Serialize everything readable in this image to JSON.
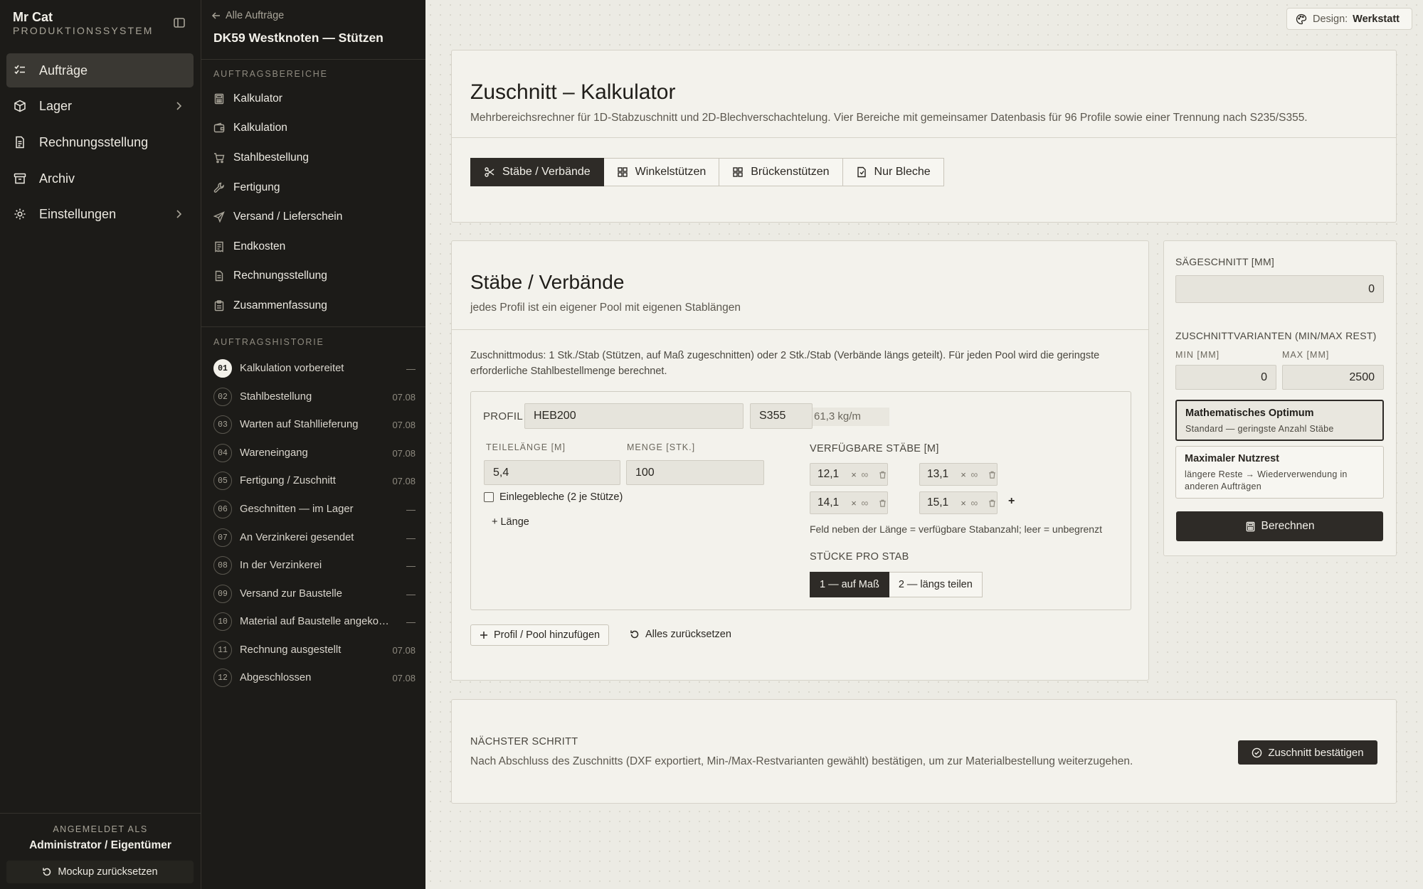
{
  "brand": {
    "name": "Mr Cat",
    "subtitle": "PRODUKTIONSSYSTEM"
  },
  "nav": [
    {
      "label": "Aufträge",
      "icon": "list-check-icon",
      "active": true
    },
    {
      "label": "Lager",
      "icon": "box-icon",
      "has_children": true
    },
    {
      "label": "Rechnungsstellung",
      "icon": "invoice-icon"
    },
    {
      "label": "Archiv",
      "icon": "archive-icon"
    },
    {
      "label": "Einstellungen",
      "icon": "gear-icon",
      "has_children": true
    }
  ],
  "user": {
    "label": "ANGEMELDET ALS",
    "name": "Administrator / Eigentümer",
    "reset_label": "Mockup zurücksetzen"
  },
  "order": {
    "back_label": "Alle Aufträge",
    "title": "DK59 Westknoten — Stützen",
    "areas_label": "AUFTRAGSBEREICHE",
    "areas": [
      {
        "label": "Kalkulator",
        "icon": "calculator-icon"
      },
      {
        "label": "Kalkulation",
        "icon": "wallet-icon"
      },
      {
        "label": "Stahlbestellung",
        "icon": "cart-icon"
      },
      {
        "label": "Fertigung",
        "icon": "wrench-icon"
      },
      {
        "label": "Versand / Lieferschein",
        "icon": "send-icon"
      },
      {
        "label": "Endkosten",
        "icon": "receipt-icon"
      },
      {
        "label": "Rechnungsstellung",
        "icon": "document-icon"
      },
      {
        "label": "Zusammenfassung",
        "icon": "clipboard-icon"
      }
    ],
    "history_label": "AUFTRAGSHISTORIE",
    "history": [
      {
        "num": "01",
        "label": "Kalkulation vorbereitet",
        "date": "—",
        "current": true
      },
      {
        "num": "02",
        "label": "Stahlbestellung",
        "date": "07.08"
      },
      {
        "num": "03",
        "label": "Warten auf Stahllieferung",
        "date": "07.08"
      },
      {
        "num": "04",
        "label": "Wareneingang",
        "date": "07.08"
      },
      {
        "num": "05",
        "label": "Fertigung / Zuschnitt",
        "date": "07.08"
      },
      {
        "num": "06",
        "label": "Geschnitten — im Lager",
        "date": "—"
      },
      {
        "num": "07",
        "label": "An Verzinkerei gesendet",
        "date": "—"
      },
      {
        "num": "08",
        "label": "In der Verzinkerei",
        "date": "—"
      },
      {
        "num": "09",
        "label": "Versand zur Baustelle",
        "date": "—"
      },
      {
        "num": "10",
        "label": "Material auf Baustelle angekommen",
        "date": "—"
      },
      {
        "num": "11",
        "label": "Rechnung ausgestellt",
        "date": "07.08"
      },
      {
        "num": "12",
        "label": "Abgeschlossen",
        "date": "07.08"
      }
    ]
  },
  "design": {
    "label": "Design:",
    "value": "Werkstatt"
  },
  "calculator": {
    "title": "Zuschnitt – Kalkulator",
    "subtitle": "Mehrbereichsrechner für 1D-Stabzuschnitt und 2D-Blechverschachtelung. Vier Bereiche mit gemeinsamer Datenbasis für 96 Profile sowie einer Trennung nach S235/S355.",
    "tabs": [
      {
        "label": "Stäbe / Verbände",
        "icon": "scissors-icon",
        "active": true
      },
      {
        "label": "Winkelstützen",
        "icon": "grid-icon"
      },
      {
        "label": "Brückenstützen",
        "icon": "grid-icon"
      },
      {
        "label": "Nur Bleche",
        "icon": "sheet-icon"
      }
    ]
  },
  "staebe": {
    "title": "Stäbe / Verbände",
    "subtitle": "jedes Profil ist ein eigener Pool mit eigenen Stablängen",
    "mode_text": "Zuschnittmodus: 1 Stk./Stab (Stützen, auf Maß zugeschnitten) oder 2 Stk./Stab (Verbände längs geteilt). Für jeden Pool wird die geringste erforderliche Stahlbestellmenge berechnet.",
    "pool": {
      "profile_label": "PROFIL",
      "profile": "HEB200",
      "grade": "S355",
      "weight": "61,3 kg/m",
      "length_label": "TEILELÄNGE [M]",
      "qty_label": "MENGE [STK.]",
      "length": "5,4",
      "qty": "100",
      "checkbox_label": "Einlegebleche (2 je Stütze)",
      "checkbox_checked": false,
      "add_length": "+ Länge",
      "bars_label": "VERFÜGBARE STÄBE [M]",
      "bars": [
        {
          "value": "12,1",
          "x": "×",
          "count": "∞"
        },
        {
          "value": "13,1",
          "x": "×",
          "count": "∞"
        },
        {
          "value": "14,1",
          "x": "×",
          "count": "∞"
        },
        {
          "value": "15,1",
          "x": "×",
          "count": "∞"
        }
      ],
      "add_bar": "+",
      "bars_hint": "Feld neben der Länge = verfügbare Stabanzahl; leer = unbegrenzt",
      "per_bar_label": "STÜCKE PRO STAB",
      "per_bar_options": [
        {
          "label": "1 — auf Maß",
          "active": true
        },
        {
          "label": "2 — längs teilen"
        }
      ]
    },
    "add_pool": "Profil / Pool hinzufügen",
    "reset_all": "Alles zurücksetzen"
  },
  "settings": {
    "saw_label": "SÄGESCHNITT [MM]",
    "saw_value": "0",
    "variants_label": "ZUSCHNITTVARIANTEN (MIN/MAX REST)",
    "min_label": "MIN [MM]",
    "max_label": "MAX [MM]",
    "min_value": "0",
    "max_value": "2500",
    "variants": [
      {
        "title": "Mathematisches Optimum",
        "desc": "Standard — geringste Anzahl Stäbe",
        "selected": true
      },
      {
        "title": "Maximaler Nutzrest",
        "desc": "längere Reste → Wiederverwendung in anderen Aufträgen"
      }
    ],
    "calc_button": "Berechnen"
  },
  "next_step": {
    "label": "NÄCHSTER SCHRITT",
    "text": "Nach Abschluss des Zuschnitts (DXF exportiert, Min-/Max-Restvarianten gewählt) bestätigen, um zur Materialbestellung weiterzugehen.",
    "button": "Zuschnitt bestätigen"
  }
}
